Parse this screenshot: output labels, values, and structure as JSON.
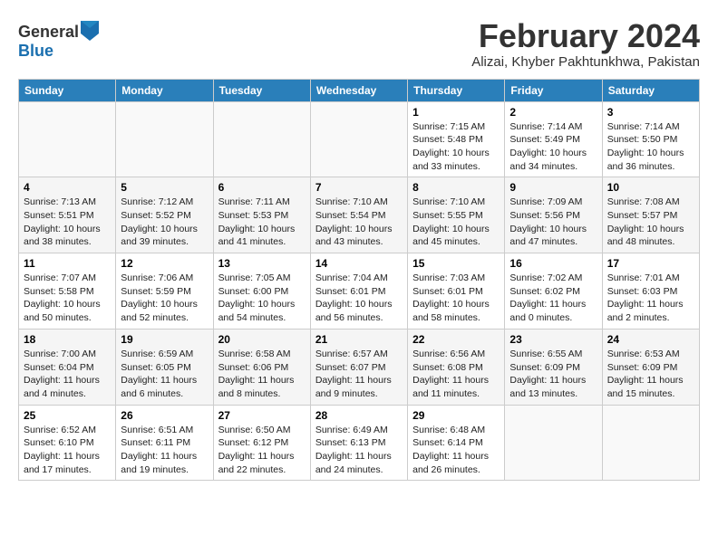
{
  "header": {
    "logo_general": "General",
    "logo_blue": "Blue",
    "month_title": "February 2024",
    "subtitle": "Alizai, Khyber Pakhtunkhwa, Pakistan"
  },
  "days_of_week": [
    "Sunday",
    "Monday",
    "Tuesday",
    "Wednesday",
    "Thursday",
    "Friday",
    "Saturday"
  ],
  "weeks": [
    [
      {
        "day": "",
        "text": ""
      },
      {
        "day": "",
        "text": ""
      },
      {
        "day": "",
        "text": ""
      },
      {
        "day": "",
        "text": ""
      },
      {
        "day": "1",
        "text": "Sunrise: 7:15 AM\nSunset: 5:48 PM\nDaylight: 10 hours\nand 33 minutes."
      },
      {
        "day": "2",
        "text": "Sunrise: 7:14 AM\nSunset: 5:49 PM\nDaylight: 10 hours\nand 34 minutes."
      },
      {
        "day": "3",
        "text": "Sunrise: 7:14 AM\nSunset: 5:50 PM\nDaylight: 10 hours\nand 36 minutes."
      }
    ],
    [
      {
        "day": "4",
        "text": "Sunrise: 7:13 AM\nSunset: 5:51 PM\nDaylight: 10 hours\nand 38 minutes."
      },
      {
        "day": "5",
        "text": "Sunrise: 7:12 AM\nSunset: 5:52 PM\nDaylight: 10 hours\nand 39 minutes."
      },
      {
        "day": "6",
        "text": "Sunrise: 7:11 AM\nSunset: 5:53 PM\nDaylight: 10 hours\nand 41 minutes."
      },
      {
        "day": "7",
        "text": "Sunrise: 7:10 AM\nSunset: 5:54 PM\nDaylight: 10 hours\nand 43 minutes."
      },
      {
        "day": "8",
        "text": "Sunrise: 7:10 AM\nSunset: 5:55 PM\nDaylight: 10 hours\nand 45 minutes."
      },
      {
        "day": "9",
        "text": "Sunrise: 7:09 AM\nSunset: 5:56 PM\nDaylight: 10 hours\nand 47 minutes."
      },
      {
        "day": "10",
        "text": "Sunrise: 7:08 AM\nSunset: 5:57 PM\nDaylight: 10 hours\nand 48 minutes."
      }
    ],
    [
      {
        "day": "11",
        "text": "Sunrise: 7:07 AM\nSunset: 5:58 PM\nDaylight: 10 hours\nand 50 minutes."
      },
      {
        "day": "12",
        "text": "Sunrise: 7:06 AM\nSunset: 5:59 PM\nDaylight: 10 hours\nand 52 minutes."
      },
      {
        "day": "13",
        "text": "Sunrise: 7:05 AM\nSunset: 6:00 PM\nDaylight: 10 hours\nand 54 minutes."
      },
      {
        "day": "14",
        "text": "Sunrise: 7:04 AM\nSunset: 6:01 PM\nDaylight: 10 hours\nand 56 minutes."
      },
      {
        "day": "15",
        "text": "Sunrise: 7:03 AM\nSunset: 6:01 PM\nDaylight: 10 hours\nand 58 minutes."
      },
      {
        "day": "16",
        "text": "Sunrise: 7:02 AM\nSunset: 6:02 PM\nDaylight: 11 hours\nand 0 minutes."
      },
      {
        "day": "17",
        "text": "Sunrise: 7:01 AM\nSunset: 6:03 PM\nDaylight: 11 hours\nand 2 minutes."
      }
    ],
    [
      {
        "day": "18",
        "text": "Sunrise: 7:00 AM\nSunset: 6:04 PM\nDaylight: 11 hours\nand 4 minutes."
      },
      {
        "day": "19",
        "text": "Sunrise: 6:59 AM\nSunset: 6:05 PM\nDaylight: 11 hours\nand 6 minutes."
      },
      {
        "day": "20",
        "text": "Sunrise: 6:58 AM\nSunset: 6:06 PM\nDaylight: 11 hours\nand 8 minutes."
      },
      {
        "day": "21",
        "text": "Sunrise: 6:57 AM\nSunset: 6:07 PM\nDaylight: 11 hours\nand 9 minutes."
      },
      {
        "day": "22",
        "text": "Sunrise: 6:56 AM\nSunset: 6:08 PM\nDaylight: 11 hours\nand 11 minutes."
      },
      {
        "day": "23",
        "text": "Sunrise: 6:55 AM\nSunset: 6:09 PM\nDaylight: 11 hours\nand 13 minutes."
      },
      {
        "day": "24",
        "text": "Sunrise: 6:53 AM\nSunset: 6:09 PM\nDaylight: 11 hours\nand 15 minutes."
      }
    ],
    [
      {
        "day": "25",
        "text": "Sunrise: 6:52 AM\nSunset: 6:10 PM\nDaylight: 11 hours\nand 17 minutes."
      },
      {
        "day": "26",
        "text": "Sunrise: 6:51 AM\nSunset: 6:11 PM\nDaylight: 11 hours\nand 19 minutes."
      },
      {
        "day": "27",
        "text": "Sunrise: 6:50 AM\nSunset: 6:12 PM\nDaylight: 11 hours\nand 22 minutes."
      },
      {
        "day": "28",
        "text": "Sunrise: 6:49 AM\nSunset: 6:13 PM\nDaylight: 11 hours\nand 24 minutes."
      },
      {
        "day": "29",
        "text": "Sunrise: 6:48 AM\nSunset: 6:14 PM\nDaylight: 11 hours\nand 26 minutes."
      },
      {
        "day": "",
        "text": ""
      },
      {
        "day": "",
        "text": ""
      }
    ]
  ]
}
